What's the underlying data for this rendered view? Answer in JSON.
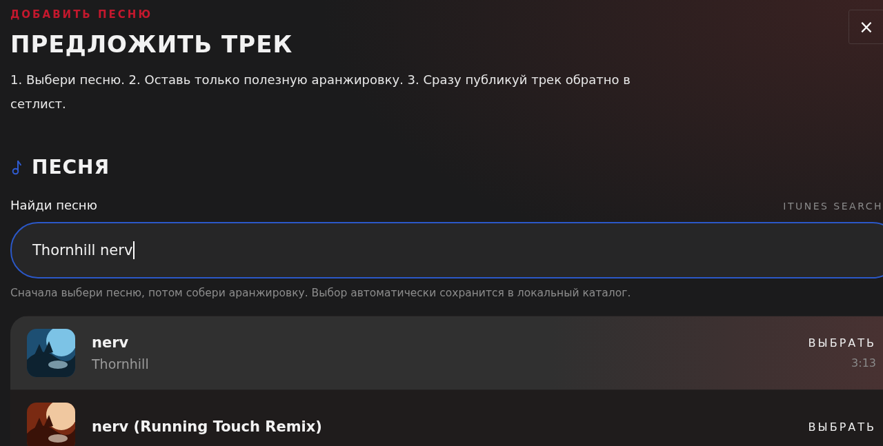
{
  "eyebrow": "ДОБАВИТЬ ПЕСНЮ",
  "title": "ПРЕДЛОЖИТЬ ТРЕК",
  "close_button": "×",
  "intro": "1. Выбери песню. 2. Оставь только полезную аранжировку. 3. Сразу публикуй трек обратно в сетлист.",
  "section": {
    "title": "ПЕСНЯ"
  },
  "search": {
    "label": "Найди песню",
    "source": "ITUNES SEARCH",
    "value": "Thornhill nerv",
    "focused": true,
    "hint": "Сначала выбери песню, потом собери аранжировку. Выбор автоматически сохранится в локальный каталог."
  },
  "results": [
    {
      "kind": "picture",
      "title": "nerv",
      "artist": "Thornhill",
      "action": "ВЫБРАТЬ",
      "duration": "3:13",
      "selected": true
    },
    {
      "kind": "picture",
      "title": "nerv (Running Touch Remix)",
      "action": "ВЫБРАТЬ",
      "selected": false
    }
  ]
}
